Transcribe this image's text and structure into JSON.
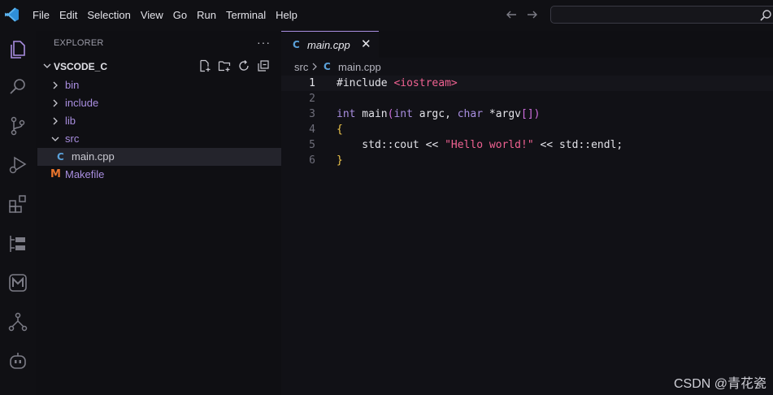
{
  "menu": [
    "File",
    "Edit",
    "Selection",
    "View",
    "Go",
    "Run",
    "Terminal",
    "Help"
  ],
  "activity_icons": [
    "explorer-icon",
    "search-icon",
    "source-control-icon",
    "run-debug-icon",
    "extensions-icon",
    "remote-explorer-icon",
    "cmake-icon",
    "git-graph-icon",
    "copilot-icon"
  ],
  "explorer": {
    "title": "EXPLORER",
    "more": "···",
    "folder": "VSCODE_C",
    "items": [
      {
        "label": "bin",
        "kind": "folder",
        "expanded": false
      },
      {
        "label": "include",
        "kind": "folder",
        "expanded": false
      },
      {
        "label": "lib",
        "kind": "folder",
        "expanded": false
      },
      {
        "label": "src",
        "kind": "folder",
        "expanded": true
      },
      {
        "label": "main.cpp",
        "kind": "cpp",
        "selected": true
      },
      {
        "label": "Makefile",
        "kind": "makefile"
      }
    ]
  },
  "editor": {
    "tab": {
      "label": "main.cpp",
      "close": "✕"
    },
    "breadcrumb": [
      "src",
      "main.cpp"
    ],
    "lines": [
      {
        "num": "1",
        "current": true,
        "tokens": [
          [
            "#include ",
            "t-ppd"
          ],
          [
            "<iostream>",
            "t-inc"
          ]
        ]
      },
      {
        "num": "2",
        "tokens": []
      },
      {
        "num": "3",
        "tokens": [
          [
            "int",
            "t-kw"
          ],
          [
            " main",
            "t-id"
          ],
          [
            "(",
            "t-brk"
          ],
          [
            "int",
            "t-kw"
          ],
          [
            " argc",
            "t-id"
          ],
          [
            ", ",
            "t-punct"
          ],
          [
            "char",
            "t-kw"
          ],
          [
            " *argv",
            "t-id"
          ],
          [
            "[",
            "t-brk"
          ],
          [
            "]",
            "t-brk"
          ],
          [
            ")",
            "t-brk"
          ]
        ]
      },
      {
        "num": "4",
        "tokens": [
          [
            "{",
            "t-brace"
          ]
        ]
      },
      {
        "num": "5",
        "tokens": [
          [
            "    std",
            "t-ns"
          ],
          [
            "::",
            "t-punct"
          ],
          [
            "cout",
            "t-id"
          ],
          [
            " << ",
            "t-punct"
          ],
          [
            "\"Hello world!\"",
            "t-str"
          ],
          [
            " << ",
            "t-punct"
          ],
          [
            "std",
            "t-ns"
          ],
          [
            "::",
            "t-punct"
          ],
          [
            "endl",
            "t-id"
          ],
          [
            ";",
            "t-punct"
          ]
        ]
      },
      {
        "num": "6",
        "tokens": [
          [
            "}",
            "t-brace"
          ]
        ]
      }
    ]
  },
  "icon_glyphs": {
    "cpp": "C",
    "makefile": "M"
  },
  "colors": {
    "accent": "#a98ee0",
    "cpp_icon": "#5aa0d8",
    "makefile_icon": "#e8742c",
    "string": "#f06292",
    "brace": "#f2c94c"
  },
  "watermark": "CSDN @青花瓷"
}
